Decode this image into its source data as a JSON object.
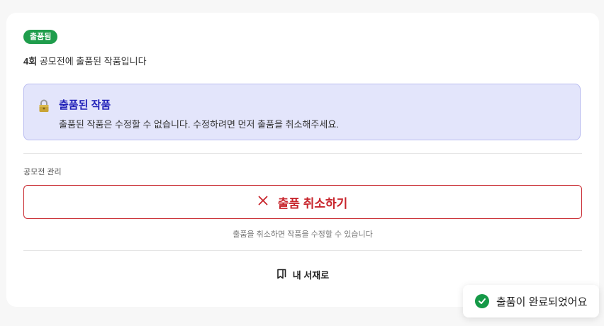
{
  "status_badge": "출품됨",
  "subtitle": {
    "round": "4회",
    "text": " 공모전에 출품된 작품입니다"
  },
  "notice": {
    "icon": "lock-icon",
    "title": "출품된 작품",
    "text": "출품된 작품은 수정할 수 없습니다. 수정하려면 먼저 출품을 취소해주세요."
  },
  "manage": {
    "section_label": "공모전 관리",
    "cancel_label": "출품 취소하기",
    "hint": "출품을 취소하면 작품을 수정할 수 있습니다"
  },
  "bookshelf": {
    "label": "내 서재로",
    "icon": "bookmark-book-icon"
  },
  "toast": {
    "message": "출품이 완료되었어요",
    "icon": "check-circle-icon"
  },
  "colors": {
    "badge": "#1f9d4c",
    "notice_bg": "#e3e5fb",
    "notice_title": "#2020b8",
    "danger": "#c8262d",
    "success": "#159947"
  }
}
